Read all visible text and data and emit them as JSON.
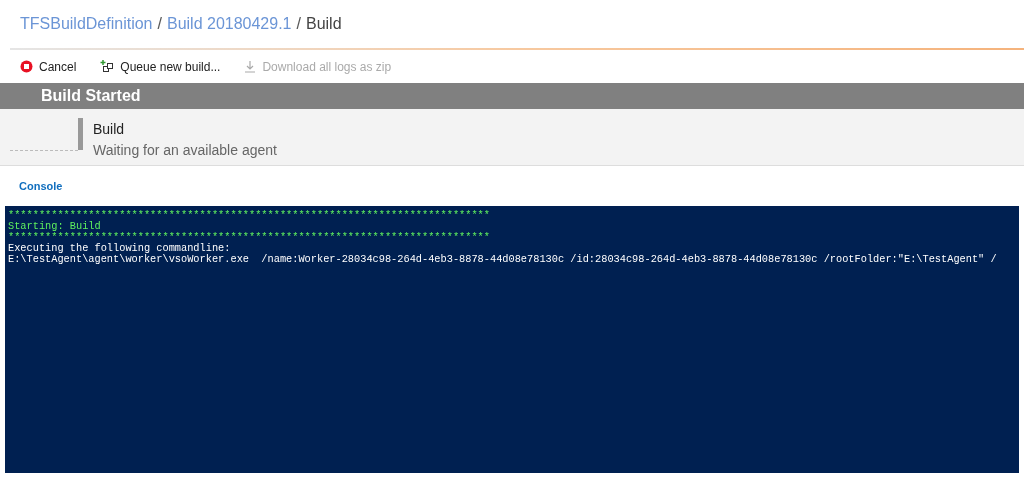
{
  "breadcrumb": [
    {
      "label": "TFSBuildDefinition",
      "kind": "link"
    },
    {
      "label": "Build 20180429.1",
      "kind": "link"
    },
    {
      "label": "Build",
      "kind": "current"
    }
  ],
  "breadcrumb_separator": "/",
  "toolbar": [
    {
      "label": "Cancel",
      "kind": "cancel",
      "disabled": false
    },
    {
      "label": "Queue new build...",
      "kind": "queue",
      "disabled": false
    },
    {
      "label": "Download all logs as zip",
      "kind": "download",
      "disabled": true
    }
  ],
  "banner": {
    "title": "Build Started"
  },
  "job": {
    "name": "Build",
    "status": "Waiting for an available agent"
  },
  "tabs": [
    {
      "label": "Console",
      "selected": true
    }
  ],
  "console": [
    {
      "text": "******************************************************************************",
      "kind": "highlight"
    },
    {
      "text": "Starting: Build",
      "kind": "highlight"
    },
    {
      "text": "******************************************************************************",
      "kind": "highlight"
    },
    {
      "text": "Executing the following commandline:",
      "kind": "normal"
    },
    {
      "text": "E:\\TestAgent\\agent\\worker\\vsoWorker.exe  /name:Worker-28034c98-264d-4eb3-8878-44d08e78130c /id:28034c98-264d-4eb3-8878-44d08e78130c /rootFolder:\"E:\\TestAgent\" /",
      "kind": "normal"
    }
  ]
}
